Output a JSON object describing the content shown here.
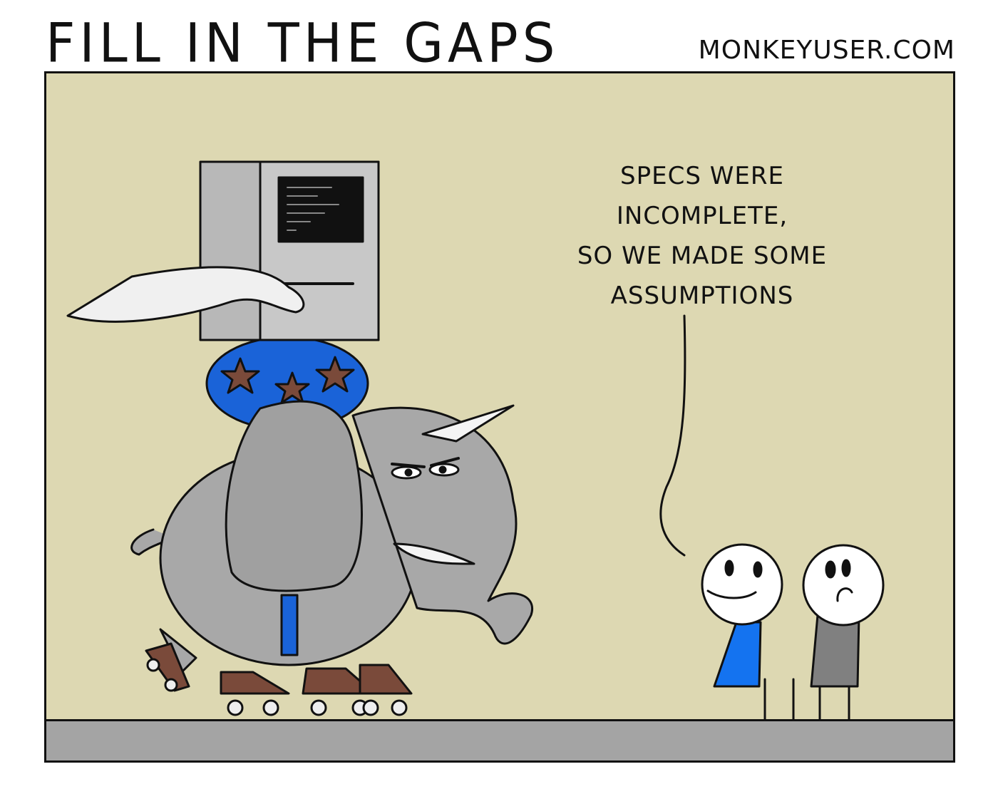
{
  "header": {
    "title": "FILL IN THE GAPS",
    "site": "MONKEYUSER.COM"
  },
  "speech_bubble": {
    "lines": [
      "SPECS WERE",
      "INCOMPLETE,",
      "SO WE MADE SOME",
      "ASSUMPTIONS"
    ]
  },
  "colors": {
    "background": "#ddd8b2",
    "floor": "#a4a4a4",
    "shirt_blue": "#1473f0",
    "shirt_gray": "#808080",
    "elephant": "#a8a8a8"
  }
}
